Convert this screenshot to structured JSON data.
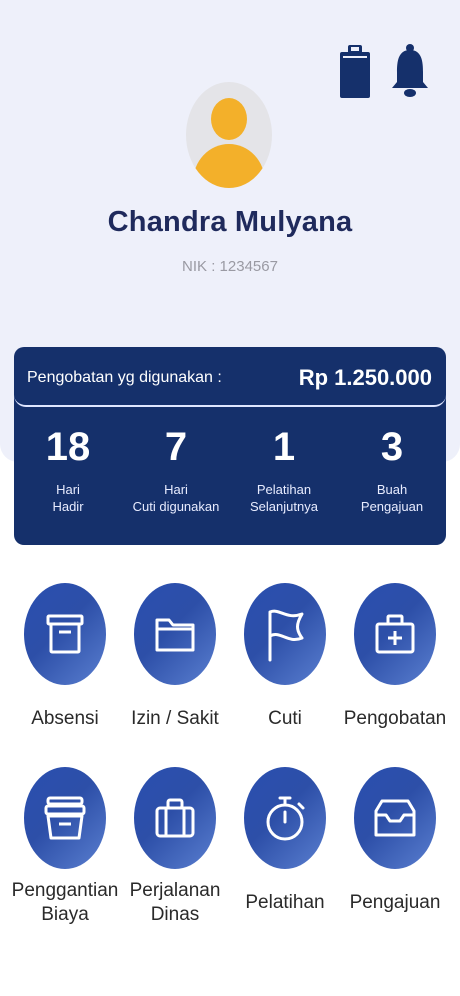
{
  "header": {
    "icons": [
      "clipboard-icon",
      "bell-icon"
    ]
  },
  "profile": {
    "name": "Chandra Mulyana",
    "nik": "NIK : 1234567"
  },
  "summary": {
    "label": "Pengobatan yg digunakan :",
    "amount": "Rp 1.250.000",
    "stats": [
      {
        "value": "18",
        "label": "Hari\nHadir"
      },
      {
        "value": "7",
        "label": "Hari\nCuti digunakan"
      },
      {
        "value": "1",
        "label": "Pelatihan\nSelanjutnya"
      },
      {
        "value": "3",
        "label": "Buah\nPengajuan"
      }
    ]
  },
  "menu": [
    {
      "label": "Absensi",
      "icon": "archive-box-icon"
    },
    {
      "label": "Izin / Sakit",
      "icon": "folder-icon"
    },
    {
      "label": "Cuti",
      "icon": "flag-icon"
    },
    {
      "label": "Pengobatan",
      "icon": "medical-kit-icon"
    },
    {
      "label": "Penggantian\nBiaya",
      "icon": "tray-stack-icon"
    },
    {
      "label": "Perjalanan\nDinas",
      "icon": "suitcase-icon"
    },
    {
      "label": "Pelatihan",
      "icon": "stopwatch-icon"
    },
    {
      "label": "Pengajuan",
      "icon": "inbox-icon"
    }
  ],
  "colors": {
    "primary": "#15306b",
    "accent": "#2d4fa8",
    "avatar": "#f3b02a",
    "header_bg": "#eef0fa"
  }
}
